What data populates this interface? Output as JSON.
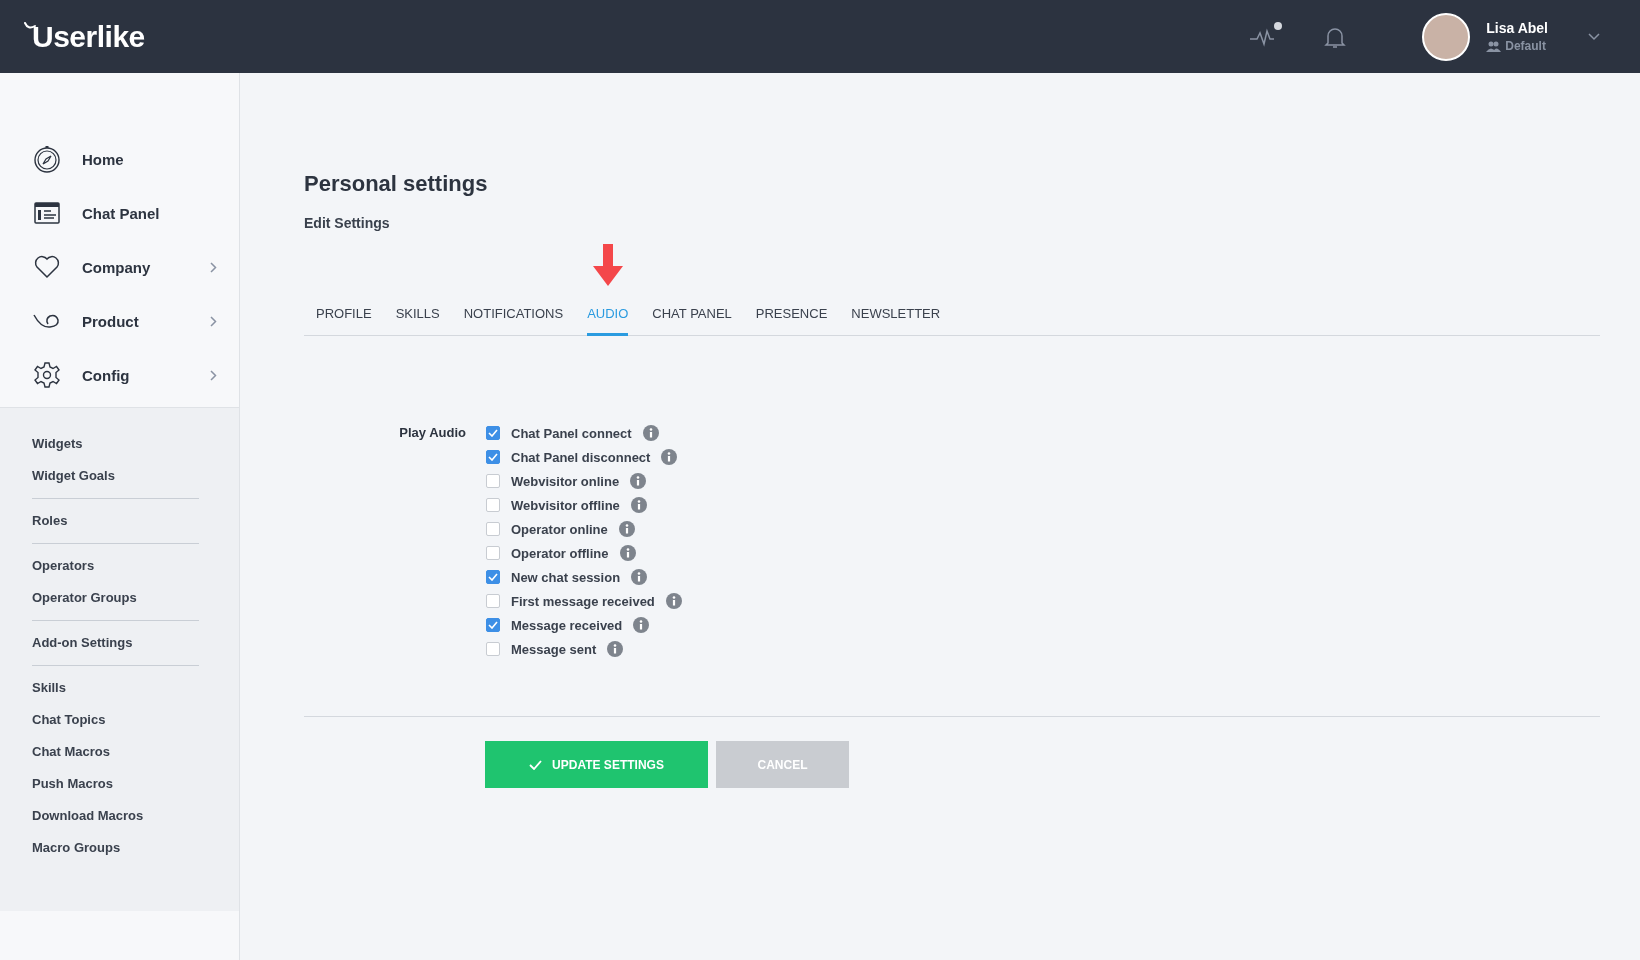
{
  "header": {
    "logo": "Userlike",
    "activity_indicator": true,
    "user": {
      "name": "Lisa Abel",
      "group": "Default"
    }
  },
  "sidebar": {
    "nav": [
      {
        "label": "Home",
        "has_submenu": false
      },
      {
        "label": "Chat Panel",
        "has_submenu": false
      },
      {
        "label": "Company",
        "has_submenu": true
      },
      {
        "label": "Product",
        "has_submenu": true
      },
      {
        "label": "Config",
        "has_submenu": true
      }
    ],
    "groups": [
      [
        "Widgets",
        "Widget Goals"
      ],
      [
        "Roles"
      ],
      [
        "Operators",
        "Operator Groups"
      ],
      [
        "Add-on Settings"
      ],
      [
        "Skills",
        "Chat Topics",
        "Chat Macros",
        "Push Macros",
        "Download Macros",
        "Macro Groups"
      ]
    ]
  },
  "page": {
    "title": "Personal settings",
    "subtitle": "Edit Settings",
    "tabs": [
      {
        "label": "PROFILE",
        "selected": false,
        "arrow": false
      },
      {
        "label": "SKILLS",
        "selected": false,
        "arrow": false
      },
      {
        "label": "NOTIFICATIONS",
        "selected": false,
        "arrow": false
      },
      {
        "label": "AUDIO",
        "selected": true,
        "arrow": true
      },
      {
        "label": "CHAT PANEL",
        "selected": false,
        "arrow": false
      },
      {
        "label": "PRESENCE",
        "selected": false,
        "arrow": false
      },
      {
        "label": "NEWSLETTER",
        "selected": false,
        "arrow": false
      }
    ],
    "form": {
      "label": "Play Audio",
      "options": [
        {
          "label": "Chat Panel connect",
          "checked": true
        },
        {
          "label": "Chat Panel disconnect",
          "checked": true
        },
        {
          "label": "Webvisitor online",
          "checked": false
        },
        {
          "label": "Webvisitor offline",
          "checked": false
        },
        {
          "label": "Operator online",
          "checked": false
        },
        {
          "label": "Operator offline",
          "checked": false
        },
        {
          "label": "New chat session",
          "checked": true
        },
        {
          "label": "First message received",
          "checked": false
        },
        {
          "label": "Message received",
          "checked": true
        },
        {
          "label": "Message sent",
          "checked": false
        }
      ]
    },
    "buttons": {
      "submit": "UPDATE SETTINGS",
      "cancel": "CANCEL"
    }
  }
}
